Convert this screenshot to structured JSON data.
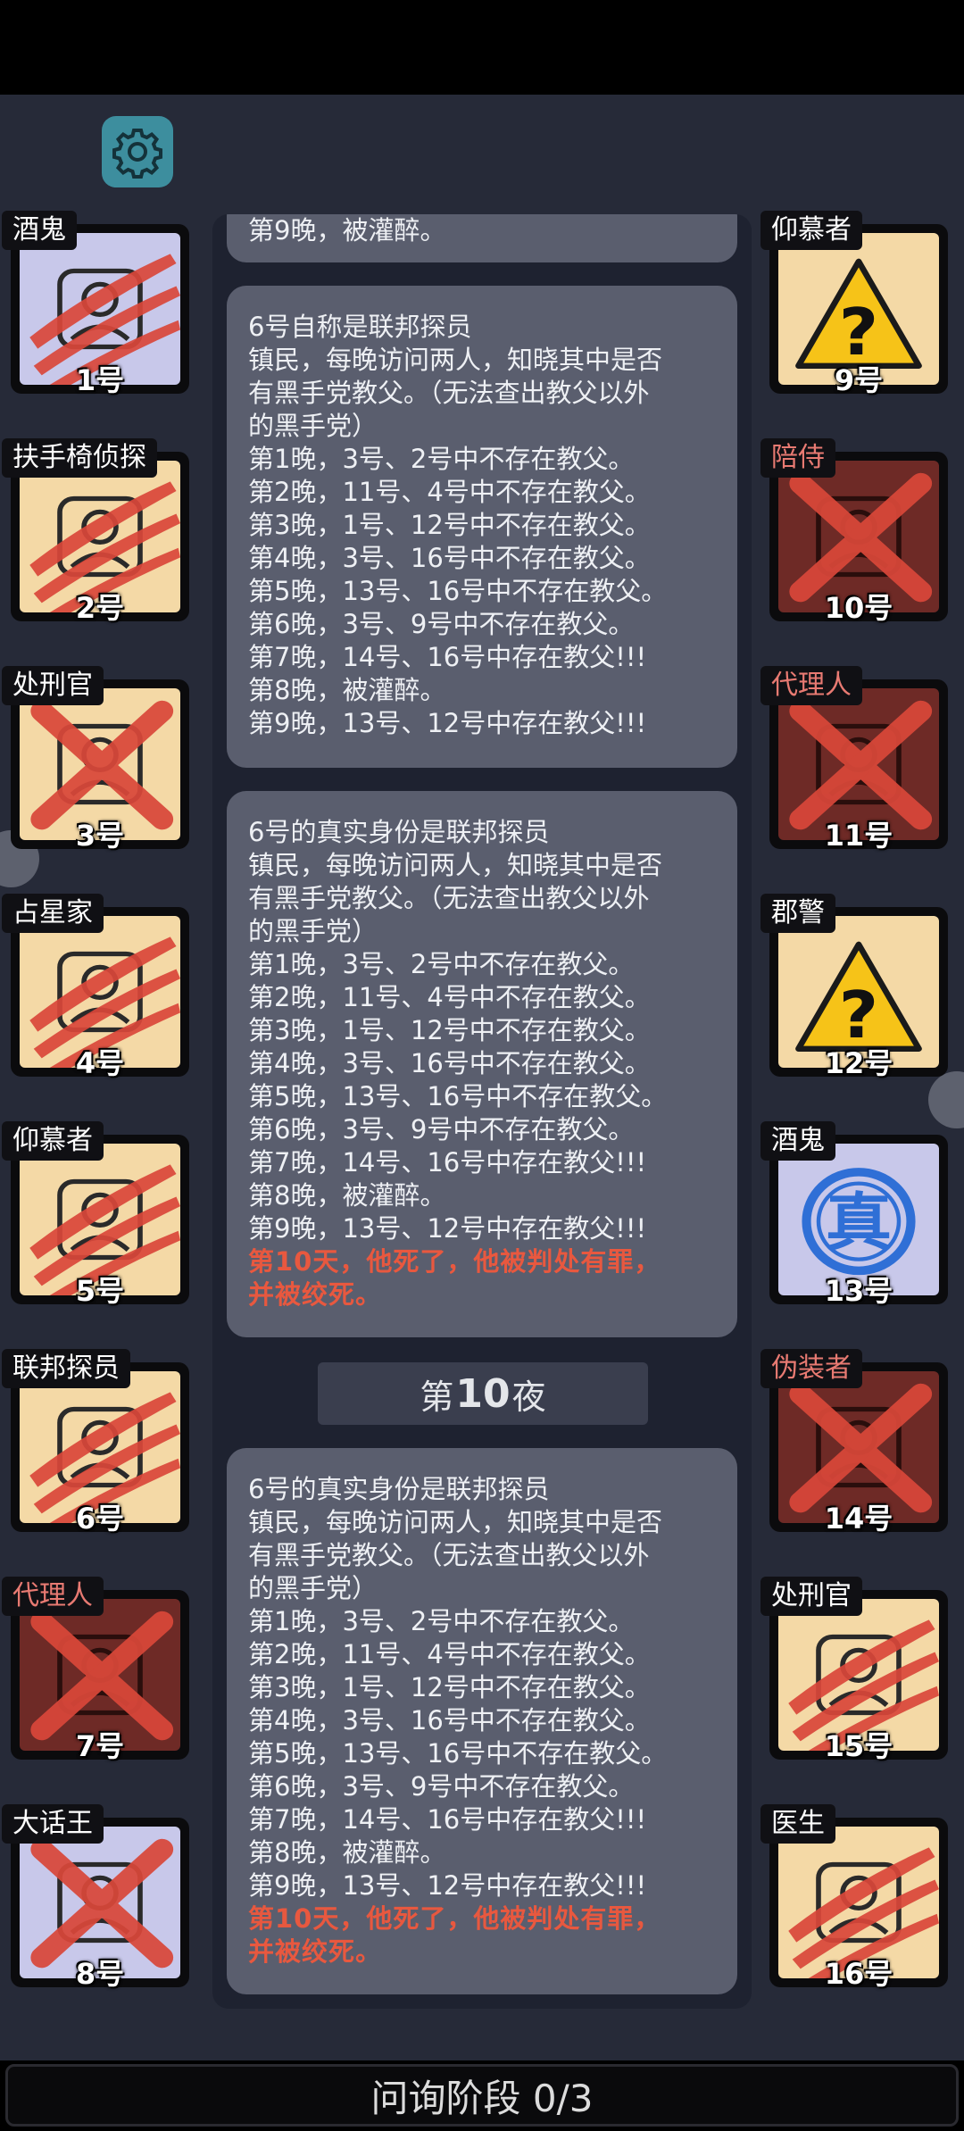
{
  "phase_label": "问询阶段 0/3",
  "night_label_prefix": "第",
  "night_number": "10",
  "night_label_suffix": "夜",
  "log": {
    "top_partial": "第9晚，被灌醉。",
    "entries": [
      {
        "title": "6号自称是联邦探员",
        "lines": [
          "镇民，每晚访问两人，知晓其中是否",
          "有黑手党教父。（无法查出教父以外",
          "的黑手党）",
          "第1晚，3号、2号中不存在教父。",
          "第2晚，11号、4号中不存在教父。",
          "第3晚，1号、12号中不存在教父。",
          "第4晚，3号、16号中不存在教父。",
          "第5晚，13号、16号中不存在教父。",
          "第6晚，3号、9号中不存在教父。",
          "第7晚，14号、16号中存在教父!!!",
          "第8晚，被灌醉。",
          "第9晚，13号、12号中存在教父!!!"
        ],
        "red_lines": []
      },
      {
        "title": "6号的真实身份是联邦探员",
        "lines": [
          "镇民，每晚访问两人，知晓其中是否",
          "有黑手党教父。（无法查出教父以外",
          "的黑手党）",
          "第1晚，3号、2号中不存在教父。",
          "第2晚，11号、4号中不存在教父。",
          "第3晚，1号、12号中不存在教父。",
          "第4晚，3号、16号中不存在教父。",
          "第5晚，13号、16号中不存在教父。",
          "第6晚，3号、9号中不存在教父。",
          "第7晚，14号、16号中存在教父!!!",
          "第8晚，被灌醉。",
          "第9晚，13号、12号中存在教父!!!"
        ],
        "red_lines": [
          "第10天，他死了，他被判处有罪，",
          "并被绞死。"
        ]
      },
      {
        "title": "6号的真实身份是联邦探员",
        "lines": [
          "镇民，每晚访问两人，知晓其中是否",
          "有黑手党教父。（无法查出教父以外",
          "的黑手党）",
          "第1晚，3号、2号中不存在教父。",
          "第2晚，11号、4号中不存在教父。",
          "第3晚，1号、12号中不存在教父。",
          "第4晚，3号、16号中不存在教父。",
          "第5晚，13号、16号中不存在教父。",
          "第6晚，3号、9号中不存在教父。",
          "第7晚，14号、16号中存在教父!!!",
          "第8晚，被灌醉。",
          "第9晚，13号、12号中存在教父!!!"
        ],
        "red_lines": [
          "第10天，他死了，他被判处有罪，",
          "并被绞死。"
        ]
      }
    ]
  },
  "players_left": [
    {
      "role": "酒鬼",
      "num": "1号",
      "bg": "#c8c8ea",
      "mark": "claw",
      "role_color": "white",
      "icon": "beer-mug-icon"
    },
    {
      "role": "扶手椅侦探",
      "num": "2号",
      "bg": "#f4d9a6",
      "mark": "claw",
      "role_color": "white",
      "icon": "armchair-icon"
    },
    {
      "role": "处刑官",
      "num": "3号",
      "bg": "#f4d9a6",
      "mark": "cross",
      "role_color": "white",
      "icon": "scroll-icon"
    },
    {
      "role": "占星家",
      "num": "4号",
      "bg": "#f4d9a6",
      "mark": "claw",
      "role_color": "white",
      "icon": "telescope-icon"
    },
    {
      "role": "仰慕者",
      "num": "5号",
      "bg": "#f4d9a6",
      "mark": "claw",
      "role_color": "white",
      "icon": "flower-icon"
    },
    {
      "role": "联邦探员",
      "num": "6号",
      "bg": "#f4d9a6",
      "mark": "claw",
      "role_color": "white",
      "icon": "id-card-icon"
    },
    {
      "role": "代理人",
      "num": "7号",
      "bg": "#6e2a26",
      "mark": "cross",
      "role_color": "red",
      "icon": "trenchcoat-icon"
    },
    {
      "role": "大话王",
      "num": "8号",
      "bg": "#c8c8ea",
      "mark": "cross",
      "role_color": "white",
      "icon": "pizza-icon"
    }
  ],
  "players_right": [
    {
      "role": "仰慕者",
      "num": "9号",
      "bg": "#f4d9a6",
      "mark": "unknown",
      "role_color": "white",
      "icon": "question-warning-icon"
    },
    {
      "role": "陪侍",
      "num": "10号",
      "bg": "#6e2a26",
      "mark": "cross",
      "role_color": "red",
      "icon": "wine-glass-icon"
    },
    {
      "role": "代理人",
      "num": "11号",
      "bg": "#6e2a26",
      "mark": "cross",
      "role_color": "red",
      "icon": "trenchcoat-icon"
    },
    {
      "role": "郡警",
      "num": "12号",
      "bg": "#f4d9a6",
      "mark": "unknown",
      "role_color": "white",
      "icon": "question-warning-icon"
    },
    {
      "role": "酒鬼",
      "num": "13号",
      "bg": "#c8c8ea",
      "mark": "stamp",
      "role_color": "white",
      "icon": "true-stamp-icon",
      "stamp_text": "真"
    },
    {
      "role": "伪装者",
      "num": "14号",
      "bg": "#6e2a26",
      "mark": "cross",
      "role_color": "red",
      "icon": "mask-icon"
    },
    {
      "role": "处刑官",
      "num": "15号",
      "bg": "#f4d9a6",
      "mark": "claw",
      "role_color": "white",
      "icon": "scroll-icon"
    },
    {
      "role": "医生",
      "num": "16号",
      "bg": "#f4d9a6",
      "mark": "claw",
      "role_color": "white",
      "icon": "syringe-icon"
    }
  ]
}
